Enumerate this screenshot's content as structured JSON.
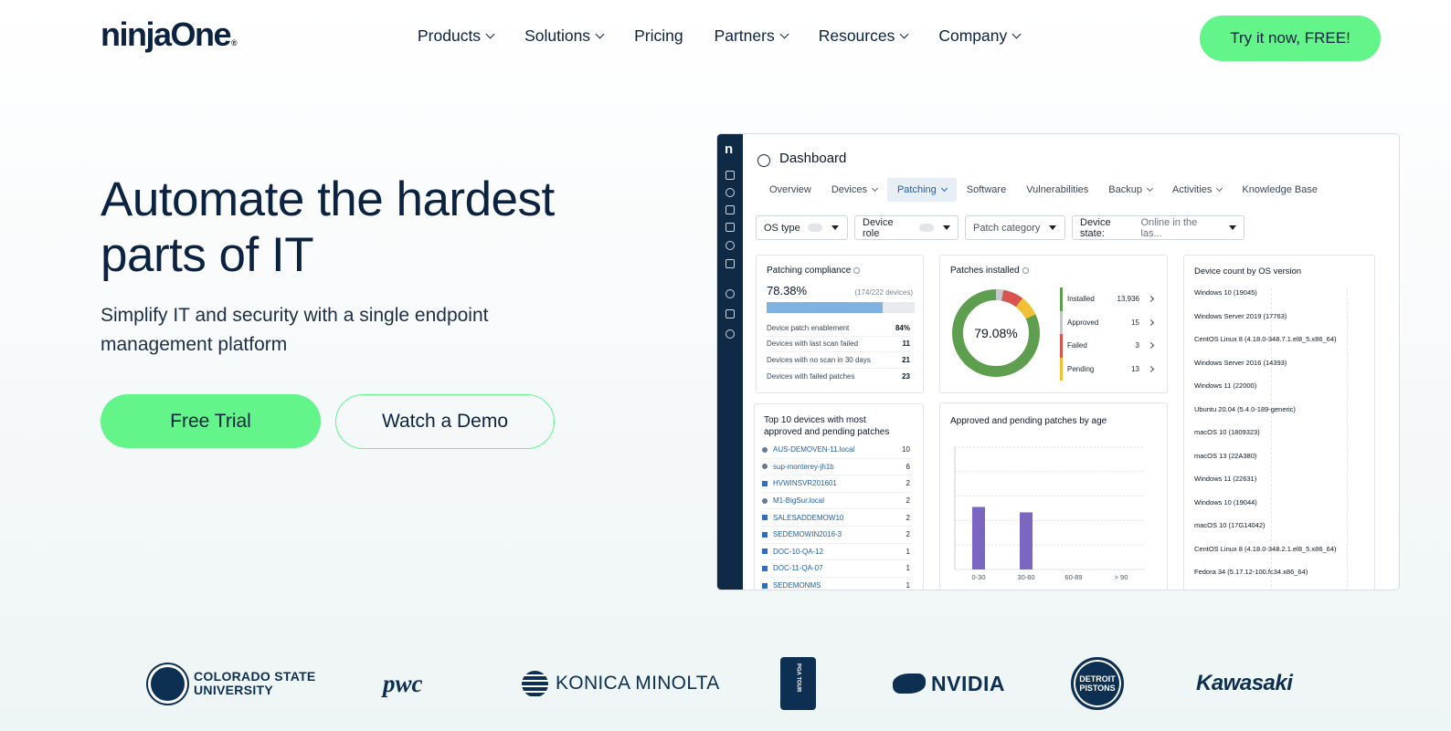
{
  "nav": {
    "logo": "ninjaOne",
    "logo_mark": "®",
    "items": [
      {
        "label": "Products",
        "dropdown": true
      },
      {
        "label": "Solutions",
        "dropdown": true
      },
      {
        "label": "Pricing",
        "dropdown": false
      },
      {
        "label": "Partners",
        "dropdown": true
      },
      {
        "label": "Resources",
        "dropdown": true
      },
      {
        "label": "Company",
        "dropdown": true
      }
    ],
    "cta": "Try it now, FREE!"
  },
  "hero": {
    "title": "Automate the hardest parts of IT",
    "subtitle": "Simplify IT and security with a single endpoint management platform",
    "primary_button": "Free Trial",
    "secondary_button": "Watch a Demo"
  },
  "dashboard": {
    "side_logo": "n",
    "title": "Dashboard",
    "tabs": [
      {
        "label": "Overview",
        "dropdown": false,
        "active": false
      },
      {
        "label": "Devices",
        "dropdown": true,
        "active": false
      },
      {
        "label": "Patching",
        "dropdown": true,
        "active": true
      },
      {
        "label": "Software",
        "dropdown": false,
        "active": false
      },
      {
        "label": "Vulnerabilities",
        "dropdown": false,
        "active": false
      },
      {
        "label": "Backup",
        "dropdown": true,
        "active": false
      },
      {
        "label": "Activities",
        "dropdown": true,
        "active": false
      },
      {
        "label": "Knowledge Base",
        "dropdown": false,
        "active": false
      }
    ],
    "filters": {
      "os_type": "OS type",
      "device_role": "Device role",
      "patch_category": "Patch category",
      "device_state_label": "Device state:",
      "device_state_value": "Online in the las..."
    },
    "compliance": {
      "title": "Patching compliance",
      "percent": "78.38%",
      "percent_value": 78.38,
      "note": "(174/222 devices)",
      "rows": [
        {
          "label": "Device patch enablement",
          "value": "84%"
        },
        {
          "label": "Devices with last scan failed",
          "value": "11"
        },
        {
          "label": "Devices with no scan in 30 days",
          "value": "21"
        },
        {
          "label": "Devices with failed patches",
          "value": "23"
        }
      ]
    },
    "patches_installed": {
      "title": "Patches installed",
      "center": "79.08%",
      "legend": [
        {
          "label": "Installed",
          "value": "13,936",
          "color": "#5e9e4f"
        },
        {
          "label": "Approved",
          "value": "15",
          "color": "#c5c9cd"
        },
        {
          "label": "Failed",
          "value": "3",
          "color": "#d9534f"
        },
        {
          "label": "Pending",
          "value": "13",
          "color": "#f2c037"
        }
      ]
    },
    "os_count": {
      "title": "Device count by OS version",
      "items": [
        "Windows 10 (19045)",
        "Windows Server 2019 (17763)",
        "CentOS Linux 8 (4.18.0-348.7.1.el8_5.x86_64)",
        "Windows Server 2016 (14393)",
        "Windows 11 (22000)",
        "Ubuntu 20.04 (5.4.0-189-generic)",
        "macOS 10 (1809323)",
        "macOS 13 (22A380)",
        "Windows 11 (22631)",
        "Windows 10 (19044)",
        "macOS 10 (17G14042)",
        "CentOS Linux 8 (4.18.0-348.2.1.el8_5.x86_64)",
        "Fedora 34 (5.17.12-100.fc34.x86_64)"
      ]
    },
    "top10": {
      "title": "Top 10 devices with most approved and pending patches",
      "rows": [
        {
          "name": "AUS-DEMOVEN-11.local",
          "count": "10",
          "os": "mac"
        },
        {
          "name": "sup-monterey-jh1b",
          "count": "6",
          "os": "mac"
        },
        {
          "name": "HVWINSVR201601",
          "count": "2",
          "os": "win"
        },
        {
          "name": "M1-BigSur.local",
          "count": "2",
          "os": "mac"
        },
        {
          "name": "SALESADDEMOW10",
          "count": "2",
          "os": "win"
        },
        {
          "name": "SEDEMOWIN2016-3",
          "count": "2",
          "os": "win"
        },
        {
          "name": "DOC-10-QA-12",
          "count": "1",
          "os": "win"
        },
        {
          "name": "DOC-11-QA-07",
          "count": "1",
          "os": "win"
        },
        {
          "name": "SEDEMONMS",
          "count": "1",
          "os": "win"
        }
      ]
    },
    "age_chart": {
      "title": "Approved and pending patches by age"
    }
  },
  "chart_data": {
    "type": "bar",
    "categories": [
      "0-30",
      "30-60",
      "60-89",
      "> 90"
    ],
    "values": [
      23,
      21,
      0,
      0
    ],
    "ylim": [
      0,
      45
    ],
    "grid": true,
    "color": "#7b66c2"
  },
  "logos": [
    {
      "id": "csu",
      "text": "COLORADO STATE UNIVERSITY"
    },
    {
      "id": "pwc",
      "text": "pwc"
    },
    {
      "id": "konica",
      "text": "KONICA MINOLTA"
    },
    {
      "id": "pga",
      "text": "PGA TOUR"
    },
    {
      "id": "nvidia",
      "text": "NVIDIA"
    },
    {
      "id": "pistons",
      "text": "DETROIT PISTONS"
    },
    {
      "id": "kawasaki",
      "text": "Kawasaki"
    }
  ],
  "colors": {
    "accent": "#63f58a",
    "navy": "#0b2240",
    "sidebar": "#0f2a44",
    "link": "#1f5fa8"
  }
}
